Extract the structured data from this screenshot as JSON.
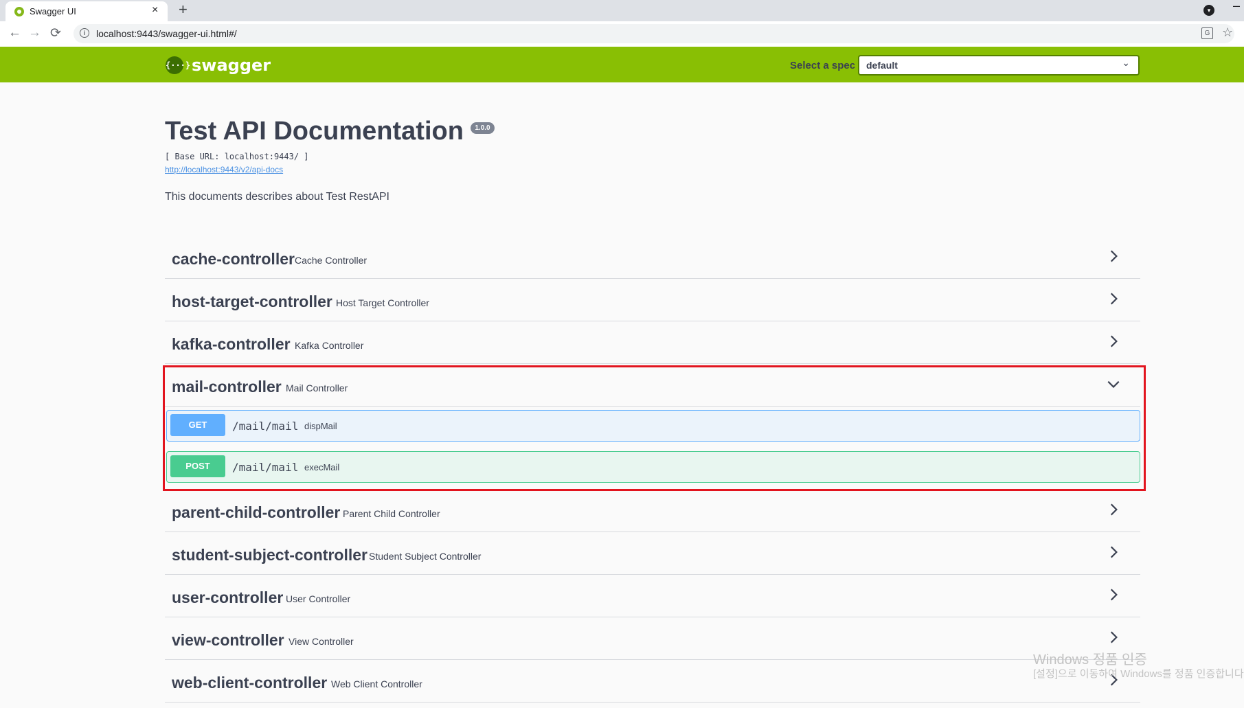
{
  "browser": {
    "tab_title": "Swagger UI",
    "tab_close": "×",
    "new_tab": "+",
    "url": "localhost:9443/swagger-ui.html#/",
    "back": "←",
    "forward": "→",
    "reload": "⟳",
    "info_glyph": "i",
    "star": "☆",
    "translate_glyph": "G",
    "minimize": "–",
    "profile_glyph": "▾"
  },
  "topbar": {
    "logo_glyph": "{···}",
    "logo_text": "swagger",
    "spec_label": "Select a spec",
    "spec_value": "default",
    "spec_chevron": "⌄"
  },
  "info": {
    "title": "Test API Documentation",
    "version": "1.0.0",
    "base_url": "[ Base URL: localhost:9443/ ]",
    "api_docs_link": "http://localhost:9443/v2/api-docs",
    "description": "This documents describes about Test RestAPI"
  },
  "tags": [
    {
      "name": "cache-controller",
      "description": "Cache Controller",
      "expanded": false
    },
    {
      "name": "host-target-controller",
      "description": "Host Target Controller",
      "expanded": false
    },
    {
      "name": "kafka-controller",
      "description": "Kafka Controller",
      "expanded": false
    },
    {
      "name": "mail-controller",
      "description": "Mail Controller",
      "expanded": true
    },
    {
      "name": "parent-child-controller",
      "description": "Parent Child Controller",
      "expanded": false
    },
    {
      "name": "student-subject-controller",
      "description": "Student Subject Controller",
      "expanded": false
    },
    {
      "name": "user-controller",
      "description": "User Controller",
      "expanded": false
    },
    {
      "name": "view-controller",
      "description": "View Controller",
      "expanded": false
    },
    {
      "name": "web-client-controller",
      "description": "Web Client Controller",
      "expanded": false
    }
  ],
  "mail_operations": [
    {
      "method": "GET",
      "path": "/mail/mail",
      "summary": "dispMail"
    },
    {
      "method": "POST",
      "path": "/mail/mail",
      "summary": "execMail"
    }
  ],
  "colors": {
    "topbar": "#89bf04",
    "get": "#61affe",
    "post": "#49cc90",
    "highlight": "#e2141e"
  },
  "watermark": {
    "line1": "Windows 정품 인증",
    "line2": "[설정]으로 이동하여 Windows를 정품 인증합니다."
  }
}
